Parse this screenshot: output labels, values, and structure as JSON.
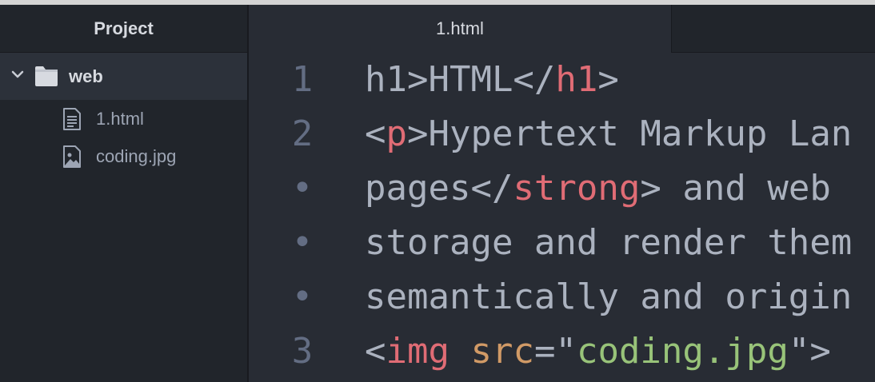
{
  "sidebar": {
    "title": "Project",
    "folder": {
      "name": "web",
      "expanded": true,
      "icon": "folder-icon"
    },
    "files": [
      {
        "name": "1.html",
        "icon": "file-text-icon"
      },
      {
        "name": "coding.jpg",
        "icon": "file-image-icon"
      }
    ]
  },
  "tabs": [
    {
      "label": "1.html",
      "active": true
    }
  ],
  "editor": {
    "lines": [
      {
        "gutter": "1",
        "tokens": [
          {
            "t": "h1",
            "c": "text"
          },
          {
            "t": ">HTML</",
            "c": "text"
          },
          {
            "t": "h1",
            "c": "tag"
          },
          {
            "t": ">",
            "c": "text"
          }
        ]
      },
      {
        "gutter": "2",
        "tokens": [
          {
            "t": "<",
            "c": "text"
          },
          {
            "t": "p",
            "c": "tag"
          },
          {
            "t": ">Hypertext Markup Lan",
            "c": "text"
          }
        ]
      },
      {
        "gutter": "•",
        "tokens": [
          {
            "t": "pages</",
            "c": "text"
          },
          {
            "t": "strong",
            "c": "tag"
          },
          {
            "t": "> and web",
            "c": "text"
          }
        ]
      },
      {
        "gutter": "•",
        "tokens": [
          {
            "t": "storage and render them",
            "c": "text"
          }
        ]
      },
      {
        "gutter": "•",
        "tokens": [
          {
            "t": "semantically and origin",
            "c": "text"
          }
        ]
      },
      {
        "gutter": "3",
        "tokens": [
          {
            "t": "<",
            "c": "text"
          },
          {
            "t": "img",
            "c": "tag"
          },
          {
            "t": " ",
            "c": "text"
          },
          {
            "t": "src",
            "c": "attr"
          },
          {
            "t": "=\"",
            "c": "text"
          },
          {
            "t": "coding.jpg",
            "c": "str"
          },
          {
            "t": "\">",
            "c": "text"
          }
        ]
      }
    ]
  },
  "colors": {
    "background": "#282c34",
    "sidebar": "#21252b",
    "selected_row": "#2c313a",
    "text": "#abb2bf",
    "tag": "#e06c75",
    "attribute": "#d19a66",
    "string": "#98c379",
    "gutter": "#636d83"
  }
}
